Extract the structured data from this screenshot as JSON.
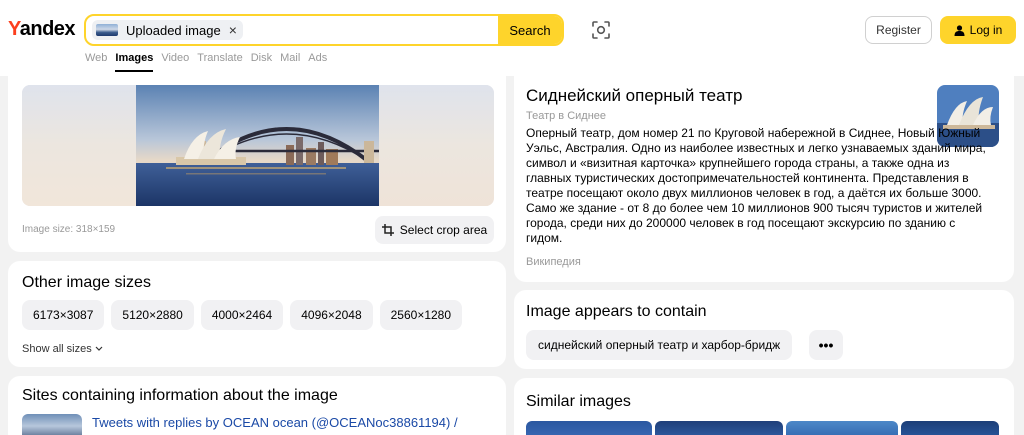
{
  "header": {
    "logo": "Yandex",
    "chip_label": "Uploaded image",
    "chip_close": "×",
    "search_label": "Search",
    "register_label": "Register",
    "login_label": "Log in"
  },
  "nav": {
    "items": [
      {
        "label": "Web"
      },
      {
        "label": "Images",
        "active": true
      },
      {
        "label": "Video"
      },
      {
        "label": "Translate"
      },
      {
        "label": "Disk"
      },
      {
        "label": "Mail"
      },
      {
        "label": "Ads"
      }
    ]
  },
  "hero": {
    "image_size": "Image size: 318×159",
    "crop_label": "Select crop area"
  },
  "sizes": {
    "title": "Other image sizes",
    "items": [
      "6173×3087",
      "5120×2880",
      "4000×2464",
      "4096×2048",
      "2560×1280"
    ],
    "show_all": "Show all sizes"
  },
  "sites": {
    "title": "Sites containing information about the image",
    "link": "Tweets with replies by OCEAN ocean (@OCEANoc38861194) /"
  },
  "info": {
    "title": "Сиднейский оперный театр",
    "subtitle": "Театр в Сиднее",
    "text": "Оперный театр, дом номер 21 по Круговой набережной в Сиднее, Новый Южный Уэльс, Австралия. Одно из наиболее известных и легко узнаваемых зданий мира, символ и «визитная карточка» крупнейшего города страны, а также одна из главных туристических достопримечательностей континента. Представления в театре посещают около двух миллионов человек в год, а даётся их больше 3000. Само же здание - от 8 до более чем 10 миллионов 900 тысяч туристов и жителей города, среди них до 200000 человек в год посещают экскурсию по зданию с гидом.",
    "source": "Википедия"
  },
  "contain": {
    "title": "Image appears to contain",
    "pill": "сиднейский оперный театр и харбор-бридж",
    "more": "•••"
  },
  "similar": {
    "title": "Similar images"
  },
  "colors": {
    "accent": "#fed42b",
    "logo_y": "#fc3f1d",
    "link": "#1a49a6"
  }
}
